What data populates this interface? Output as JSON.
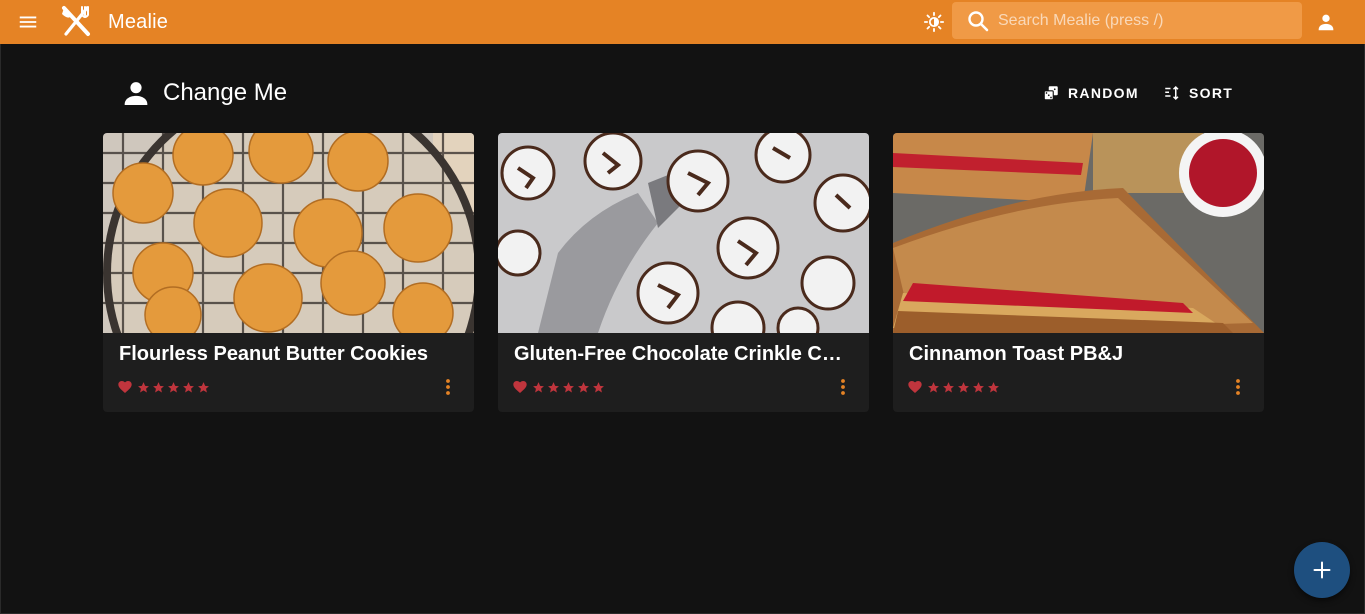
{
  "colors": {
    "primary": "#e58325",
    "background": "#121212",
    "card": "#1e1e1e",
    "rating": "#c0353d",
    "menu_dots": "#e58325",
    "fab": "#1e4f7f"
  },
  "appbar": {
    "title": "Mealie",
    "menu_icon": "menu-icon",
    "logo_icon": "fork-knife-logo-icon",
    "theme_icon": "brightness-icon",
    "account_icon": "account-icon"
  },
  "search": {
    "placeholder": "Search Mealie (press /)",
    "value": "",
    "icon": "search-icon"
  },
  "section": {
    "title": "Change Me",
    "icon": "account-icon"
  },
  "toolbar": {
    "random_label": "RANDOM",
    "sort_label": "SORT"
  },
  "recipes": [
    {
      "title": "Flourless Peanut Butter Cookies",
      "rating": 0,
      "favorite": true
    },
    {
      "title": "Gluten-Free Chocolate Crinkle Cookies",
      "rating": 0,
      "favorite": true
    },
    {
      "title": "Cinnamon Toast PB&J",
      "rating": 0,
      "favorite": true
    }
  ],
  "fab": {
    "icon": "plus-icon"
  }
}
